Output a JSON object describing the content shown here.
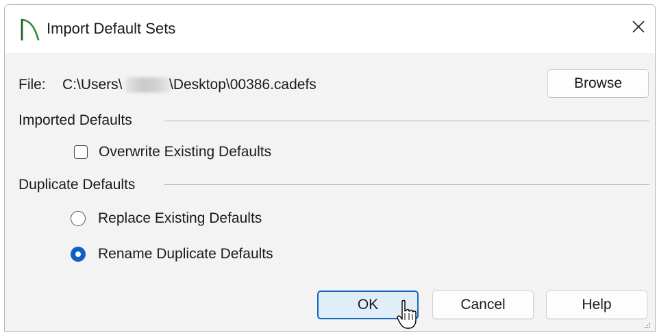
{
  "window": {
    "title": "Import Default Sets",
    "close_symbol": "✕"
  },
  "file": {
    "label": "File:",
    "path_prefix": "C:\\Users\\",
    "path_suffix": "\\Desktop\\00386.cadefs",
    "browse_label": "Browse"
  },
  "imported_defaults": {
    "group_title": "Imported Defaults",
    "overwrite_label": "Overwrite Existing Defaults",
    "overwrite_checked": false
  },
  "duplicate_defaults": {
    "group_title": "Duplicate Defaults",
    "options": [
      {
        "label": "Replace Existing Defaults",
        "selected": false
      },
      {
        "label": "Rename Duplicate Defaults",
        "selected": true
      }
    ]
  },
  "buttons": {
    "ok": "OK",
    "cancel": "Cancel",
    "help": "Help"
  },
  "colors": {
    "accent": "#0f5fc4",
    "ok_border": "#1668b8",
    "ok_fill": "#e0eef9",
    "app_icon": "#2e8b3a"
  },
  "icons": {
    "app": "cad-app-icon",
    "close": "close-icon",
    "cursor": "mouse-pointer-icon"
  }
}
